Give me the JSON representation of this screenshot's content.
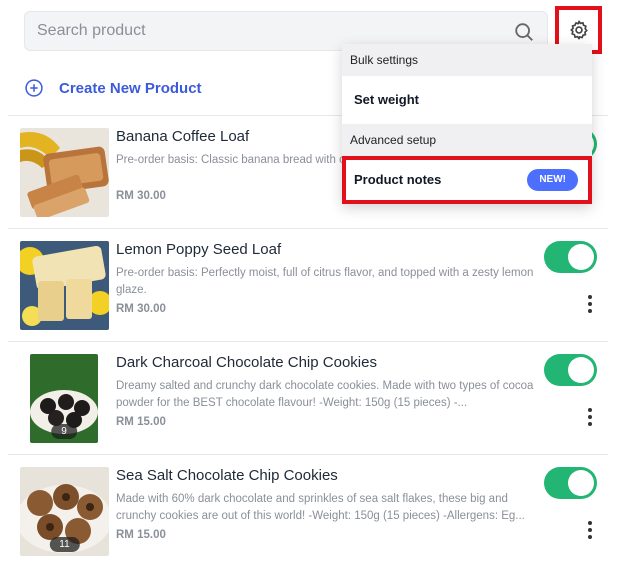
{
  "search": {
    "placeholder": "Search product",
    "icon": "search-icon"
  },
  "toolbar": {
    "settings_icon": "gear-icon",
    "settings_highlight_color": "#e2101a"
  },
  "create": {
    "label": "Create New Product",
    "icon": "plus-circle-icon",
    "color": "#3b5bdb"
  },
  "dropdown": {
    "sections": [
      {
        "header": "Bulk settings",
        "items": [
          {
            "label": "Set weight"
          }
        ]
      },
      {
        "header": "Advanced setup",
        "items": [
          {
            "label": "Product notes",
            "badge": "NEW!"
          }
        ]
      }
    ]
  },
  "products": [
    {
      "name": "Banana Coffee Loaf",
      "description": "Pre-order basis: Classic banana bread with coffee cake.",
      "price": "RM 30.00",
      "enabled": true,
      "image": "banana-loaf"
    },
    {
      "name": "Lemon Poppy Seed Loaf",
      "description": "Pre-order basis: Perfectly moist, full of citrus flavor, and topped with a zesty lemon glaze.",
      "price": "RM 30.00",
      "enabled": true,
      "image": "lemon-loaf"
    },
    {
      "name": "Dark Charcoal Chocolate Chip Cookies",
      "description": "Dreamy salted and crunchy dark chocolate cookies. Made with two types of cocoa powder for the BEST chocolate flavour! -Weight: 150g (15 pieces) -...",
      "price": "RM 15.00",
      "enabled": true,
      "image": "charcoal-cookies",
      "image_badge": "9"
    },
    {
      "name": "Sea Salt Chocolate Chip Cookies",
      "description": "Made with 60% dark chocolate and sprinkles of sea salt flakes, these big and crunchy cookies are out of this world! -Weight: 150g (15 pieces) -Allergens: Eg...",
      "price": "RM 15.00",
      "enabled": true,
      "image": "seasalt-cookies",
      "image_badge": "11"
    }
  ],
  "colors": {
    "toggle_on": "#22b573",
    "badge_new": "#4c6fff"
  }
}
